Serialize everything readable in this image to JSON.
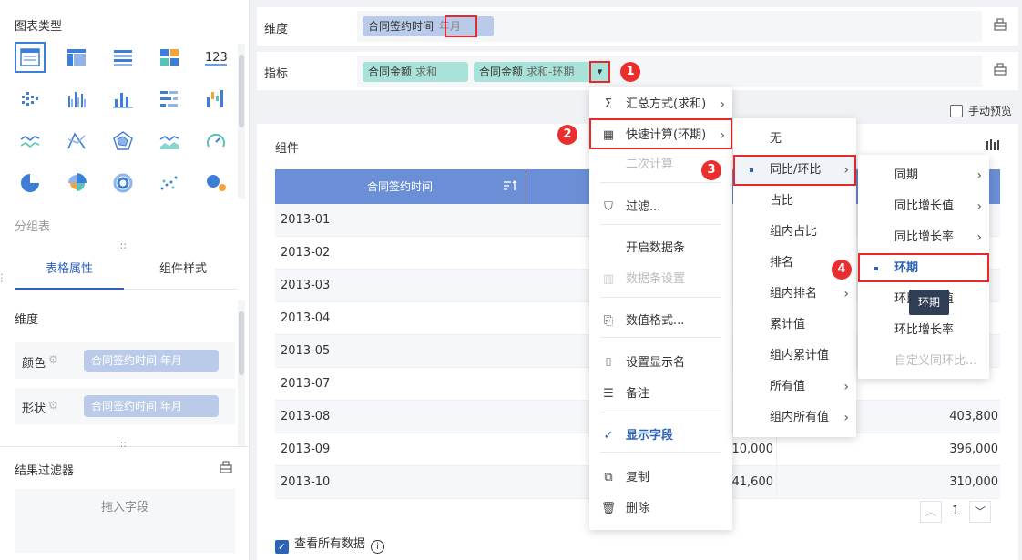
{
  "left": {
    "title": "图表类型",
    "charts": [
      {
        "name": "table-chart-icon",
        "kind": "table"
      },
      {
        "name": "crosstab-chart-icon",
        "kind": "crosstab"
      },
      {
        "name": "detail-table-icon",
        "kind": "detail"
      },
      {
        "name": "dashboard-block-icon",
        "kind": "blocks"
      },
      {
        "name": "number-card-icon",
        "kind": "number",
        "text": "123"
      },
      {
        "name": "scatter-bar-icon",
        "kind": "dotbar"
      },
      {
        "name": "grouped-bar-icon",
        "kind": "groupbar"
      },
      {
        "name": "bar-chart-icon",
        "kind": "bar"
      },
      {
        "name": "horizontal-bar-icon",
        "kind": "hbar"
      },
      {
        "name": "waterfall-icon",
        "kind": "waterfall"
      },
      {
        "name": "line-chart-icon",
        "kind": "line"
      },
      {
        "name": "radar-line-icon",
        "kind": "xline"
      },
      {
        "name": "radar-chart-icon",
        "kind": "radar"
      },
      {
        "name": "area-chart-icon",
        "kind": "area"
      },
      {
        "name": "gauge-icon",
        "kind": "gauge"
      },
      {
        "name": "pie-chart-icon",
        "kind": "pie"
      },
      {
        "name": "rose-chart-icon",
        "kind": "rose"
      },
      {
        "name": "ring-chart-icon",
        "kind": "ring"
      },
      {
        "name": "scatter-chart-icon",
        "kind": "scatter"
      },
      {
        "name": "bubble-chart-icon",
        "kind": "bubble"
      }
    ],
    "group_label": "分组表",
    "tabs": [
      "表格属性",
      "组件样式"
    ],
    "prop_title": "维度",
    "props": [
      {
        "label": "颜色",
        "field": "合同签约时间",
        "sub": "年月"
      },
      {
        "label": "形状",
        "field": "合同签约时间",
        "sub": "年月"
      }
    ],
    "filter_title": "结果过滤器",
    "drop_hint": "拖入字段"
  },
  "dim_row": {
    "label": "维度",
    "field": "合同签约时间",
    "sub": "年月"
  },
  "metric_row": {
    "label": "指标",
    "fields": [
      {
        "name": "合同金额",
        "sub": "求和"
      },
      {
        "name": "合同金额",
        "sub": "求和-环期"
      }
    ],
    "dropdown_glyph": "▾"
  },
  "badges": [
    "1",
    "2",
    "3",
    "4"
  ],
  "preview_label": "手动预览",
  "component": {
    "title": "组件",
    "header_col1": "合同签约时间",
    "rows": [
      {
        "date": "2013-01",
        "v2": "",
        "v3": ""
      },
      {
        "date": "2013-02",
        "v2": "",
        "v3": ""
      },
      {
        "date": "2013-03",
        "v2": "",
        "v3": ""
      },
      {
        "date": "2013-04",
        "v2": "",
        "v3": ""
      },
      {
        "date": "2013-05",
        "v2": "",
        "v3": ""
      },
      {
        "date": "2013-07",
        "v2": "",
        "v3": ""
      },
      {
        "date": "2013-08",
        "v2": "",
        "v3": "403,800"
      },
      {
        "date": "2013-09",
        "v2": "310,000",
        "v3": "396,000"
      },
      {
        "date": "2013-10",
        "v2": "341,600",
        "v3": "310,000"
      }
    ],
    "page": "1",
    "view_all": "查看所有数据"
  },
  "menu1": {
    "items": [
      {
        "name": "menu-aggregate",
        "icon": "Σ",
        "text": "汇总方式(求和)",
        "arrow": true
      },
      {
        "name": "menu-quick-calc",
        "icon": "▦",
        "text": "快速计算(环期)",
        "arrow": true
      },
      {
        "name": "menu-secondary-calc",
        "icon": "",
        "text": "二次计算",
        "disabled": true
      },
      {
        "name": "menu-filter",
        "icon": "⛉",
        "text": "过滤..."
      },
      {
        "name": "menu-databar",
        "icon": "",
        "text": "开启数据条"
      },
      {
        "name": "menu-databar-settings",
        "icon": "▥",
        "text": "数据条设置",
        "disabled": true
      },
      {
        "name": "menu-number-format",
        "icon": "⎘",
        "text": "数值格式..."
      },
      {
        "name": "menu-display-name",
        "icon": "⌷",
        "text": "设置显示名"
      },
      {
        "name": "menu-note",
        "icon": "☰",
        "text": "备注"
      },
      {
        "name": "menu-show-field",
        "icon": "✓",
        "text": "显示字段",
        "blue": true
      },
      {
        "name": "menu-copy",
        "icon": "⧉",
        "text": "复制"
      },
      {
        "name": "menu-delete",
        "icon": "🗑",
        "text": "删除"
      }
    ]
  },
  "menu2": {
    "items": [
      {
        "text": "无"
      },
      {
        "text": "同比/环比",
        "arrow": true,
        "selected": true
      },
      {
        "text": "占比"
      },
      {
        "text": "组内占比"
      },
      {
        "text": "排名"
      },
      {
        "text": "组内排名",
        "arrow": true
      },
      {
        "text": "累计值"
      },
      {
        "text": "组内累计值"
      },
      {
        "text": "所有值",
        "arrow": true
      },
      {
        "text": "组内所有值",
        "arrow": true
      }
    ]
  },
  "menu3": {
    "items": [
      {
        "text": "同期",
        "arrow": true
      },
      {
        "text": "同比增长值",
        "arrow": true
      },
      {
        "text": "同比增长率",
        "arrow": true
      },
      {
        "text": "环期",
        "selected": true
      },
      {
        "text": "环比增长值"
      },
      {
        "text": "环比增长率"
      },
      {
        "text": "自定义同环比...",
        "disabled": true
      }
    ]
  },
  "tooltip": "环期",
  "colors": {
    "accent": "#2c63b8",
    "header": "#6b8fd6",
    "red": "#e8292a",
    "teal": "#a8e2d8",
    "pill": "#b9cbe9"
  }
}
